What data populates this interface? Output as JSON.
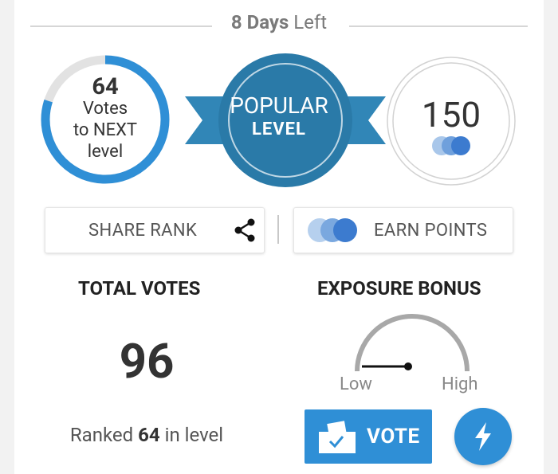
{
  "header": {
    "days_number": "8 Days",
    "days_suffix": "Left"
  },
  "progress": {
    "votes_needed": "64",
    "line1": "Votes",
    "line2": "to NEXT",
    "line3": "level",
    "fraction_complete": 0.8
  },
  "level_badge": {
    "name": "POPULAR",
    "word": "LEVEL"
  },
  "points": {
    "value": "150"
  },
  "actions": {
    "share_label": "SHARE RANK",
    "earn_label": "EARN POINTS"
  },
  "total_votes": {
    "title": "TOTAL VOTES",
    "value": "96",
    "ranked_prefix": "Ranked",
    "rank": "64",
    "ranked_suffix": "in level"
  },
  "exposure": {
    "title": "EXPOSURE BONUS",
    "low_label": "Low",
    "high_label": "High",
    "level_fraction": 0.0
  },
  "vote": {
    "label": "VOTE"
  },
  "colors": {
    "accent": "#2f8fd6",
    "badge": "#2a7aa8",
    "ring_track": "#e2e2e2"
  },
  "icons": [
    "share-icon",
    "coins-icon",
    "ballot-box-icon",
    "lightning-icon"
  ]
}
